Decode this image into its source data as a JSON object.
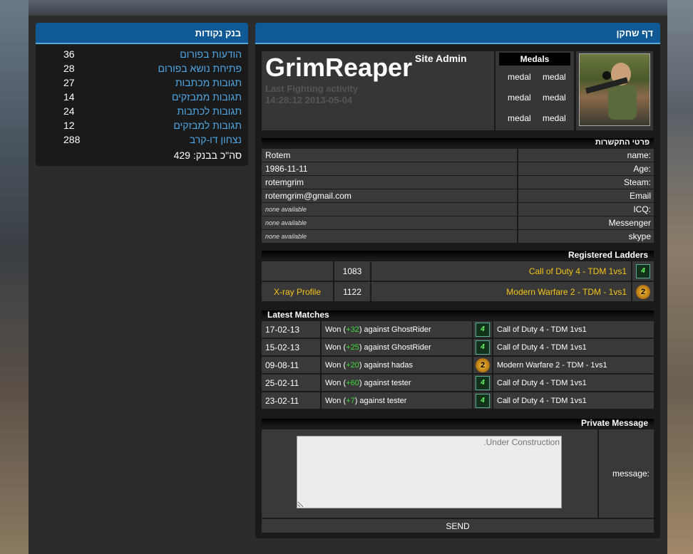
{
  "points_panel": {
    "title": "בנק נקודות",
    "rows": [
      {
        "label": "הודעות בפורום",
        "value": "36"
      },
      {
        "label": "פתיחת נושא בפורום",
        "value": "28"
      },
      {
        "label": "תגובות מכתבות",
        "value": "27"
      },
      {
        "label": "תגובות ממבזקים",
        "value": "14"
      },
      {
        "label": "תגובות לכתבות",
        "value": "24"
      },
      {
        "label": "תגובות למבזקים",
        "value": "12"
      },
      {
        "label": "נצחון דו-קרב",
        "value": "288"
      }
    ],
    "total": "סה\"כ בבנק: 429"
  },
  "player_panel": {
    "title": "דף שחקן",
    "name": "GrimReaper",
    "role": "Site Admin",
    "activity_label": "Last Fighting activity",
    "activity_time": "14:28:12 2013-05-04",
    "medals_title": "Medals",
    "medals": [
      "medal",
      "medal",
      "medal",
      "medal",
      "medal",
      "medal"
    ],
    "avatar_icon": "player-photo"
  },
  "contact": {
    "title": "פרטי התקשרות",
    "rows": [
      {
        "key": "name:",
        "value": "Rotem",
        "na": false
      },
      {
        "key": "Age:",
        "value": "1986-11-11",
        "na": false
      },
      {
        "key": "Steam:",
        "value": "rotemgrim",
        "na": false
      },
      {
        "key": "Email",
        "value": "rotemgrim@gmail.com",
        "na": false
      },
      {
        "key": "ICQ:",
        "value": "none available",
        "na": true
      },
      {
        "key": "Messenger",
        "value": "none available",
        "na": true
      },
      {
        "key": "skype",
        "value": "none available",
        "na": true
      }
    ]
  },
  "ladders": {
    "title": "Registered Ladders",
    "rows": [
      {
        "extra": "",
        "score": "1083",
        "name": "Call of Duty 4 - TDM 1vs1",
        "icon": "cod4"
      },
      {
        "extra": "X-ray Profile",
        "score": "1122",
        "name": "Modern Warfare 2 - TDM - 1vs1",
        "icon": "mw2"
      }
    ]
  },
  "matches": {
    "title": "Latest Matches",
    "rows": [
      {
        "date": "17-02-13",
        "won": "Won (",
        "pts": "+32",
        "against": ") against GhostRider",
        "game": "Call of Duty 4 - TDM 1vs1",
        "icon": "cod4"
      },
      {
        "date": "15-02-13",
        "won": "Won (",
        "pts": "+25",
        "against": ") against GhostRider",
        "game": "Call of Duty 4 - TDM 1vs1",
        "icon": "cod4"
      },
      {
        "date": "09-08-11",
        "won": "Won (",
        "pts": "+20",
        "against": ") against hadas",
        "game": "Modern Warfare 2 - TDM - 1vs1",
        "icon": "mw2"
      },
      {
        "date": "25-02-11",
        "won": "Won (",
        "pts": "+60",
        "against": ") against tester",
        "game": "Call of Duty 4 - TDM 1vs1",
        "icon": "cod4"
      },
      {
        "date": "23-02-11",
        "won": "Won (",
        "pts": "+7",
        "against": ") against tester",
        "game": "Call of Duty 4 - TDM 1vs1",
        "icon": "cod4"
      }
    ]
  },
  "pm": {
    "title": "Private Message",
    "label": "message:",
    "textarea_value": "Under Construction.",
    "send": "SEND"
  },
  "icons": {
    "cod4_text": "4",
    "mw2_text": "2"
  }
}
